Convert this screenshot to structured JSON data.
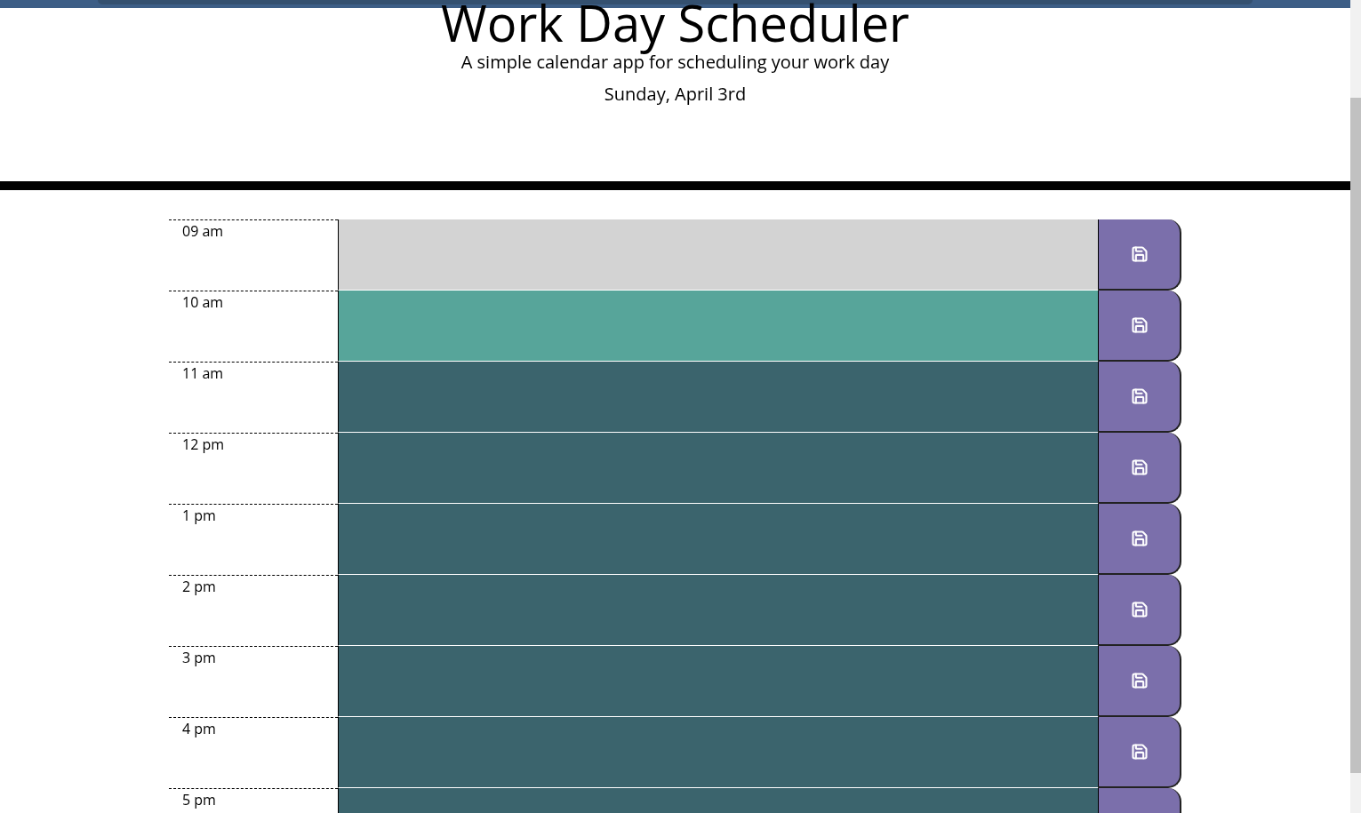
{
  "header": {
    "title": "Work Day Scheduler",
    "lead": "A simple calendar app for scheduling your work day",
    "date": "Sunday, April 3rd"
  },
  "rows": [
    {
      "hour": "09 am",
      "past": true,
      "current": false
    },
    {
      "hour": "10 am",
      "past": false,
      "current": true
    },
    {
      "hour": "11 am",
      "past": false,
      "current": false
    },
    {
      "hour": "12 pm",
      "past": false,
      "current": false
    },
    {
      "hour": "1 pm",
      "past": false,
      "current": false
    },
    {
      "hour": "2 pm",
      "past": false,
      "current": false
    },
    {
      "hour": "3 pm",
      "past": false,
      "current": false
    },
    {
      "hour": "4 pm",
      "past": false,
      "current": false
    },
    {
      "hour": "5 pm",
      "past": false,
      "current": false
    }
  ]
}
